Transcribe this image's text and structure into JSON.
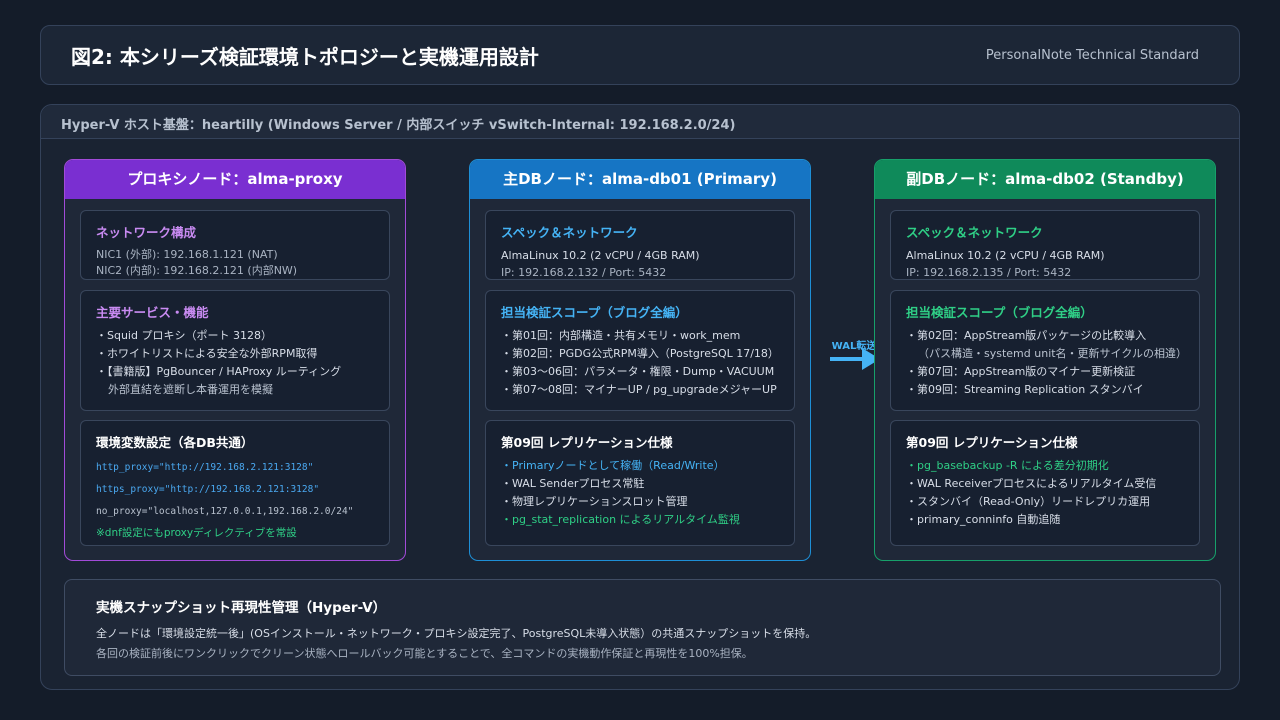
{
  "header": {
    "title": "図2: 本シリーズ検証環境トポロジーと実機運用設計",
    "brand": "PersonalNote Technical Standard"
  },
  "host": {
    "label": "Hyper-V ホスト基盤：heartilly (Windows Server / 内部スイッチ vSwitch-Internal: 192.168.2.0/24)"
  },
  "nodes": {
    "proxy": {
      "title": "プロキシノード：alma-proxy",
      "network": {
        "title": "ネットワーク構成",
        "lines": [
          "NIC1 (外部): 192.168.1.121 (NAT)",
          "NIC2 (内部): 192.168.2.121 (内部NW)"
        ]
      },
      "services": {
        "title": "主要サービス・機能",
        "lines": [
          "・Squid プロキシ（ポート 3128）",
          "・ホワイトリストによる安全な外部RPM取得",
          "・【書籍版】PgBouncer / HAProxy ルーティング",
          "外部直結を遮断し本番運用を模擬"
        ]
      },
      "env": {
        "title": "環境変数設定（各DB共通）",
        "code": [
          "http_proxy=\"http://192.168.2.121:3128\"",
          "https_proxy=\"http://192.168.2.121:3128\"",
          "no_proxy=\"localhost,127.0.0.1,192.168.2.0/24\""
        ],
        "note": "※dnf設定にもproxyディレクティブを常設"
      }
    },
    "primary": {
      "title": "主DBノード：alma-db01 (Primary)",
      "spec": {
        "title": "スペック＆ネットワーク",
        "line1": "AlmaLinux 10.2 (2 vCPU / 4GB RAM)",
        "line2": "IP: 192.168.2.132 / Port: 5432"
      },
      "scope": {
        "title": "担当検証スコープ（ブログ全編）",
        "lines": [
          "・第01回：内部構造・共有メモリ・work_mem",
          "・第02回：PGDG公式RPM導入（PostgreSQL 17/18）",
          "・第03〜06回：パラメータ・権限・Dump・VACUUM",
          "・第07〜08回：マイナーUP / pg_upgradeメジャーUP"
        ]
      },
      "repl": {
        "title": "第09回 レプリケーション仕様",
        "lines": [
          "・Primaryノードとして稼働（Read/Write）",
          "・WAL Senderプロセス常駐",
          "・物理レプリケーションスロット管理",
          "・pg_stat_replication によるリアルタイム監視"
        ]
      }
    },
    "standby": {
      "title": "副DBノード：alma-db02 (Standby)",
      "spec": {
        "title": "スペック＆ネットワーク",
        "line1": "AlmaLinux 10.2 (2 vCPU / 4GB RAM)",
        "line2": "IP: 192.168.2.135 / Port: 5432"
      },
      "scope": {
        "title": "担当検証スコープ（ブログ全編）",
        "lines": [
          "・第02回：AppStream版パッケージの比較導入",
          "（パス構造・systemd unit名・更新サイクルの相違）",
          "・第07回：AppStream版のマイナー更新検証",
          "・第09回：Streaming Replication スタンバイ"
        ]
      },
      "repl": {
        "title": "第09回 レプリケーション仕様",
        "lines": [
          "・pg_basebackup -R による差分初期化",
          "・WAL Receiverプロセスによるリアルタイム受信",
          "・スタンバイ（Read-Only）リードレプリカ運用",
          "・primary_conninfo 自動追随"
        ]
      }
    }
  },
  "arrow": {
    "label": "WAL転送"
  },
  "footer": {
    "title": "実機スナップショット再現性管理（Hyper-V）",
    "line1": "全ノードは「環境設定統一後」(OSインストール・ネットワーク・プロキシ設定完了、PostgreSQL未導入状態）の共通スナップショットを保持。",
    "line2": "各回の検証前後にワンクリックでクリーン状態へロールバック可能とすることで、全コマンドの実機動作保証と再現性を100%担保。"
  },
  "colors": {
    "proxy": "#7a2fd1",
    "primary": "#1675c4",
    "standby": "#0f8a5a",
    "background": "#141c29"
  }
}
